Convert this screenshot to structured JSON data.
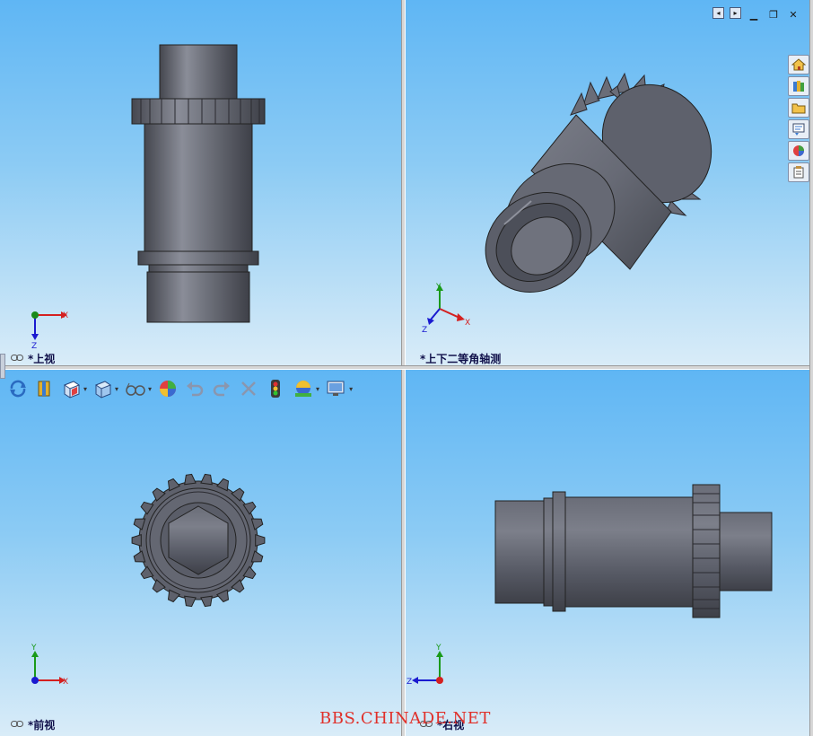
{
  "viewports": {
    "top": {
      "label": "*上视"
    },
    "iso": {
      "label": "*上下二等角轴测"
    },
    "front": {
      "label": "*前视"
    },
    "right": {
      "label": "*右视"
    }
  },
  "axes": {
    "x": "X",
    "y": "Y",
    "z": "Z"
  },
  "watermark": "BBS.CHINADE.NET",
  "toolbar": {
    "items": [
      "rotate-view-icon",
      "section-view-icon",
      "view-orientation-icon",
      "display-style-icon",
      "hide-show-items-icon",
      "edit-appearance-icon",
      "undo-icon",
      "redo-icon",
      "close-icon",
      "traffic-light-icon",
      "apply-scene-icon",
      "view-settings-icon"
    ]
  },
  "taskpane": {
    "tabs": [
      "home-icon",
      "design-library-icon",
      "file-explorer-icon",
      "view-palette-icon",
      "appearances-icon",
      "custom-properties-icon"
    ]
  },
  "colors": {
    "part": "#5a5d6a",
    "label": "#10104a",
    "watermark": "#e0302a",
    "axis_x": "#d42020",
    "axis_y": "#1a9a1a",
    "axis_z": "#1a1ad0"
  }
}
